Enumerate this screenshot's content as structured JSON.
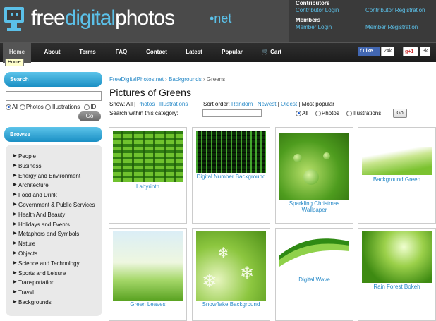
{
  "header": {
    "logo_prefix": "free",
    "logo_highlight": "digital",
    "logo_suffix": "photos",
    "logo_net": "•net"
  },
  "account": {
    "contributors_heading": "Contributors",
    "contributor_login": "Contributor Login",
    "contributor_registration": "Contributor Registration",
    "members_heading": "Members",
    "member_login": "Member Login",
    "member_registration": "Member Registration"
  },
  "nav": {
    "items": [
      "Home",
      "About",
      "Terms",
      "FAQ",
      "Contact",
      "Latest",
      "Popular",
      "Cart"
    ],
    "tooltip": "Home"
  },
  "social": {
    "like_label": "Like",
    "like_count": "24k",
    "plus_label": "+1",
    "plus_count": "3k"
  },
  "sidebar": {
    "search_title": "Search",
    "search_value": "",
    "radios": [
      "All",
      "Photos",
      "Illustrations",
      "ID"
    ],
    "go_label": "Go",
    "browse_title": "Browse",
    "categories": [
      "People",
      "Business",
      "Energy and Environment",
      "Architecture",
      "Food and Drink",
      "Government & Public Services",
      "Health And Beauty",
      "Holidays and Events",
      "Metaphors and Symbols",
      "Nature",
      "Objects",
      "Science and Technology",
      "Sports and Leisure",
      "Transportation",
      "Travel",
      "Backgrounds"
    ]
  },
  "main": {
    "breadcrumb": [
      "FreeDigitalPhotos.net",
      "Backgrounds",
      "Greens"
    ],
    "title": "Pictures of Greens",
    "show_label": "Show:",
    "show_all": "All",
    "show_photos": "Photos",
    "show_illustrations": "Illustrations",
    "sort_label": "Sort order:",
    "sort_random": "Random",
    "sort_newest": "Newest",
    "sort_oldest": "Oldest",
    "sort_popular": "Most popular",
    "search_within_label": "Search within this category:",
    "filter_all": "All",
    "filter_photos": "Photos",
    "filter_illustrations": "Illustrations",
    "go_label": "Go",
    "tiles": [
      "Labyrinth",
      "Digital Number Background",
      "Sparkling Christmas Wallpaper",
      "Background Green",
      "Green Leaves",
      "Snowflake Background",
      "Digital Wave",
      "Rain Forest Bokeh"
    ]
  },
  "colors": {
    "accent": "#2a8bc8",
    "header_bg": "#4a4a4a",
    "nav_bg": "#1c1c1c"
  }
}
